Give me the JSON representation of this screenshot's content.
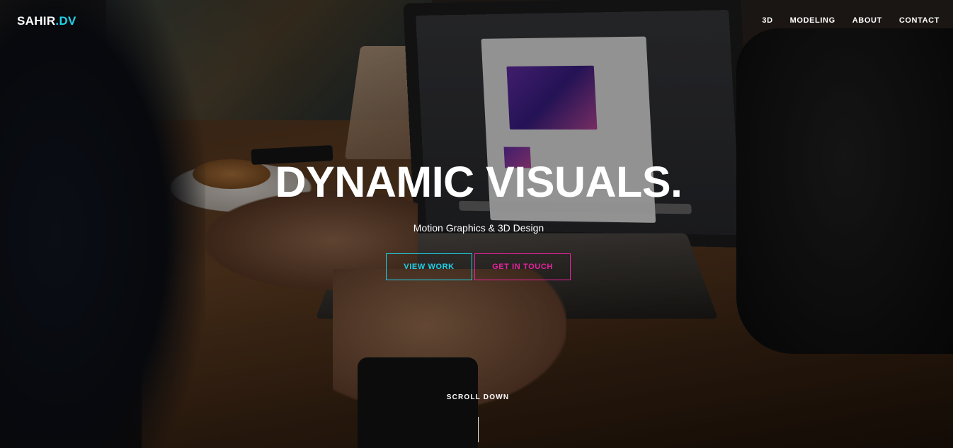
{
  "brand": {
    "name": "SAHIR",
    "suffix": ".DV",
    "accent_color": "#1fd1e8"
  },
  "nav": {
    "items": [
      {
        "label": "3D"
      },
      {
        "label": "MODELING"
      },
      {
        "label": "ABOUT"
      },
      {
        "label": "CONTACT"
      }
    ]
  },
  "hero": {
    "title": "DYNAMIC VISUALS.",
    "subtitle": "Motion Graphics & 3D Design",
    "primary_button": {
      "label": "VIEW WORK",
      "color": "#1fd1e8"
    },
    "secondary_button": {
      "label": "GET IN TOUCH",
      "color": "#e8239e"
    },
    "scroll_label": "SCROLL DOWN"
  }
}
